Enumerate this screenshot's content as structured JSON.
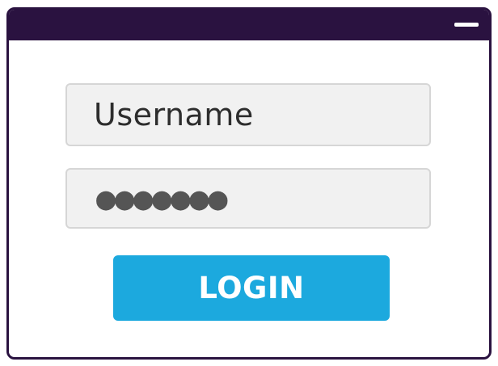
{
  "window": {
    "titlebar": {
      "minimize_icon": "minimize-icon"
    }
  },
  "login_form": {
    "username": {
      "placeholder": "Username"
    },
    "password": {
      "masked_value": "●●●●●●●"
    },
    "login_button_label": "LOGIN"
  },
  "colors": {
    "titlebar": "#2a1240",
    "button": "#1ca9de",
    "field_background": "#f1f1f1"
  }
}
